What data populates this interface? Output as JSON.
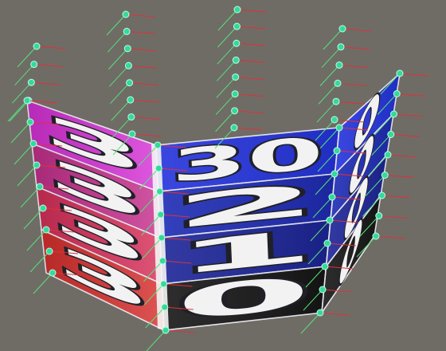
{
  "scene": {
    "background": "#6f6c66",
    "handle_color": "#36d99a",
    "axis_x_color": "#e0303a",
    "axis_y_color": "#58e07a",
    "panels": [
      {
        "name": "left-panel",
        "rows": [
          {
            "digit": "3",
            "color": "#d832d8"
          },
          {
            "digit": "3",
            "color": "#c7308e"
          },
          {
            "digit": "3",
            "color": "#d8305a"
          },
          {
            "digit": "3",
            "color": "#d8302e"
          }
        ]
      },
      {
        "name": "center-panel",
        "rows": [
          {
            "digit": "30",
            "color": "#2433dc"
          },
          {
            "digit": "2",
            "color": "#1e2bb4"
          },
          {
            "digit": "1",
            "color": "#1c2598"
          },
          {
            "digit": "0",
            "color": "#161616"
          }
        ]
      },
      {
        "name": "right-panel",
        "rows": [
          {
            "digit": "0",
            "color": "#2433dc"
          },
          {
            "digit": "0",
            "color": "#1e2bb4"
          },
          {
            "digit": "0",
            "color": "#1c2598"
          },
          {
            "digit": "0",
            "color": "#161616"
          }
        ]
      }
    ]
  }
}
